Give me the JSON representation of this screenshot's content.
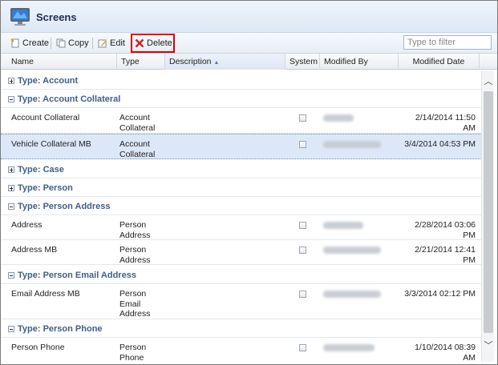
{
  "window": {
    "title": "Screens"
  },
  "toolbar": {
    "create_label": "Create",
    "copy_label": "Copy",
    "edit_label": "Edit",
    "delete_label": "Delete",
    "filter_placeholder": "Type to filter",
    "icons": [
      "create-icon",
      "copy-icon",
      "edit-icon",
      "delete-icon"
    ]
  },
  "columns": {
    "name": "Name",
    "type": "Type",
    "description": "Description",
    "system": "System",
    "modified_by": "Modified By",
    "modified_date": "Modified Date"
  },
  "groups": {
    "account": "Type: Account",
    "account_collateral": "Type: Account Collateral",
    "case": "Type: Case",
    "person": "Type: Person",
    "person_address": "Type: Person Address",
    "person_email_address": "Type: Person Email Address",
    "person_phone": "Type: Person Phone"
  },
  "rows": {
    "r1": {
      "name": "Account Collateral",
      "type": "Account Collateral",
      "date": "2/14/2014 11:50 AM"
    },
    "r2": {
      "name": "Vehicle Collateral MB",
      "type": "Account Collateral",
      "date": "3/4/2014 04:53 PM"
    },
    "r3": {
      "name": "Address",
      "type": "Person Address",
      "date": "2/28/2014 03:06 PM"
    },
    "r4": {
      "name": "Address MB",
      "type": "Person Address",
      "date": "2/21/2014 12:41 PM"
    },
    "r5": {
      "name": "Email Address MB",
      "type": "Person Email Address",
      "date": "3/3/2014 02:12 PM"
    },
    "r6": {
      "name": "Person Phone",
      "type": "Person Phone",
      "date": "1/10/2014 08:39 AM"
    }
  },
  "colors": {
    "accent": "#3e5f8a",
    "highlight": "#e00000",
    "selected_row": "#dce8f7"
  }
}
